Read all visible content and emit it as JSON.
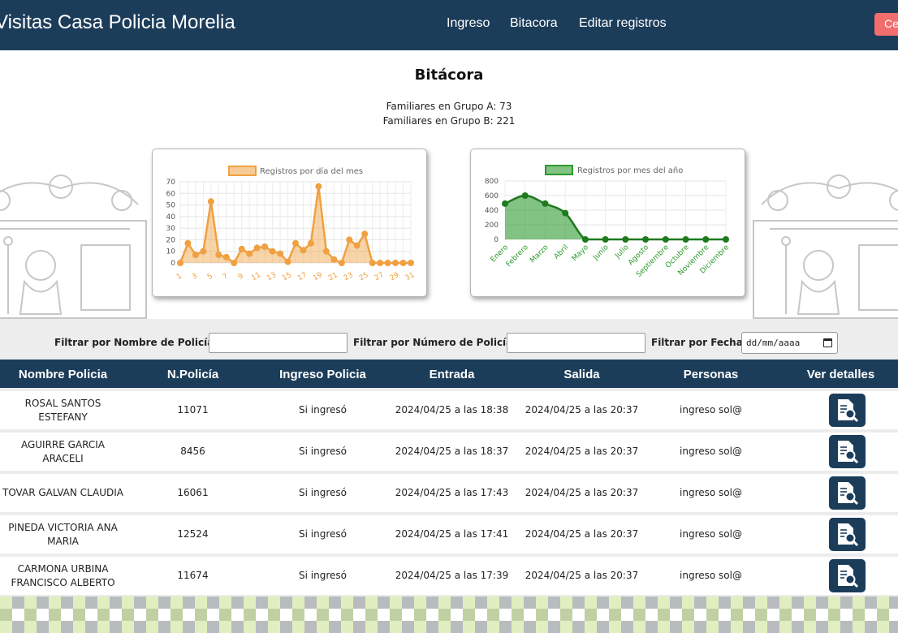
{
  "nav": {
    "brand": "Visitas Casa Policia Morelia",
    "links": [
      "Ingreso",
      "Bitacora",
      "Editar registros"
    ],
    "logout_label": "Cerrar sesión"
  },
  "page": {
    "title": "Bitácora",
    "stat_a": "Familiares en Grupo A: 73",
    "stat_b": "Familiares en Grupo B: 221"
  },
  "chart_data": [
    {
      "type": "area",
      "legend": "Registros por día del mes",
      "color": "#f0a040",
      "x": [
        1,
        2,
        3,
        4,
        5,
        6,
        7,
        8,
        9,
        10,
        11,
        12,
        13,
        14,
        15,
        16,
        17,
        18,
        19,
        20,
        21,
        22,
        23,
        24,
        25,
        26,
        27,
        28,
        29,
        30,
        31
      ],
      "x_tick_labels": [
        "1",
        "3",
        "5",
        "7",
        "9",
        "11",
        "13",
        "15",
        "17",
        "19",
        "21",
        "23",
        "25",
        "27",
        "29",
        "31"
      ],
      "y": [
        0,
        17,
        7,
        10,
        53,
        7,
        5,
        0,
        12,
        8,
        13,
        14,
        10,
        8,
        1,
        17,
        11,
        17,
        66,
        10,
        3,
        0,
        20,
        15,
        25,
        0,
        0,
        0,
        0,
        0,
        0
      ],
      "ylim": [
        0,
        70
      ],
      "y_ticks": [
        0,
        10,
        20,
        30,
        40,
        50,
        60,
        70
      ]
    },
    {
      "type": "area",
      "legend": "Registros por mes del año",
      "color": "#2e9a2e",
      "categories": [
        "Enero",
        "Febrero",
        "Marzo",
        "Abril",
        "Mayo",
        "Junio",
        "Julio",
        "Agosto",
        "Septiembre",
        "Octubre",
        "Noviembre",
        "Diciembre"
      ],
      "values": [
        490,
        600,
        490,
        360,
        0,
        0,
        0,
        0,
        0,
        0,
        0,
        0
      ],
      "ylim": [
        0,
        800
      ],
      "y_ticks": [
        0,
        200,
        400,
        600,
        800
      ]
    }
  ],
  "filters": {
    "name_label": "Filtrar por Nombre de Policía:",
    "name_value": "",
    "number_label": "Filtrar por Número de Policía:",
    "number_value": "",
    "date_label": "Filtrar por Fecha:",
    "date_placeholder": "dd/mm/aaaa"
  },
  "table": {
    "headers": [
      "Nombre Policia",
      "N.Policía",
      "Ingreso Policia",
      "Entrada",
      "Salida",
      "Personas",
      "Ver detalles"
    ],
    "rows": [
      {
        "name": "ROSAL SANTOS ESTEFANY",
        "number": "11071",
        "status": "Si ingresó",
        "entry": "2024/04/25 a las 18:38",
        "exit": "2024/04/25 a las 20:37",
        "people": "ingreso sol@"
      },
      {
        "name": "AGUIRRE GARCIA ARACELI",
        "number": "8456",
        "status": "Si ingresó",
        "entry": "2024/04/25 a las 18:37",
        "exit": "2024/04/25 a las 20:37",
        "people": "ingreso sol@"
      },
      {
        "name": "TOVAR GALVAN CLAUDIA",
        "number": "16061",
        "status": "Si ingresó",
        "entry": "2024/04/25 a las 17:43",
        "exit": "2024/04/25 a las 20:37",
        "people": "ingreso sol@"
      },
      {
        "name": "PINEDA VICTORIA ANA MARIA",
        "number": "12524",
        "status": "Si ingresó",
        "entry": "2024/04/25 a las 17:41",
        "exit": "2024/04/25 a las 20:37",
        "people": "ingreso sol@"
      },
      {
        "name": "CARMONA URBINA FRANCISCO ALBERTO",
        "number": "11674",
        "status": "Si ingresó",
        "entry": "2024/04/25 a las 17:39",
        "exit": "2024/04/25 a las 20:37",
        "people": "ingreso sol@"
      }
    ]
  },
  "icons": {
    "detail_icon": "document-search-icon",
    "calendar_icon": "calendar-icon",
    "crest": "coat-of-arms"
  }
}
